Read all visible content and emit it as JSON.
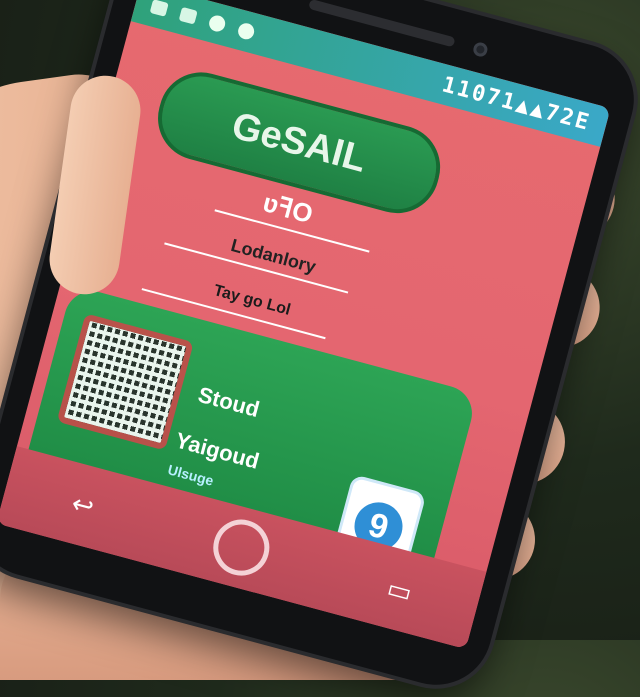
{
  "status_bar": {
    "time_text": "11071▲▲72E"
  },
  "app": {
    "pill_text": "GeSAIL",
    "subtitle": "ʋꟻO",
    "language_label": "Lodanlory",
    "small_label": "Tay go Lol"
  },
  "card": {
    "title": "Stoud",
    "subtitle": "Yaigoud",
    "link": "Ulsuge",
    "badge_text": "9"
  },
  "navigation": {
    "back_icon": "back-arrow-icon",
    "home_icon": "home-circle-icon",
    "recent_icon": "recents-square-icon"
  }
}
